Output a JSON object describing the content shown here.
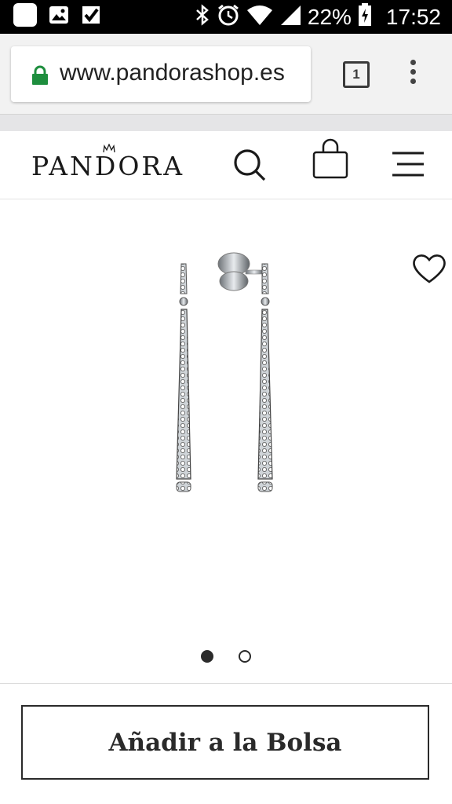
{
  "status_bar": {
    "battery": "22%",
    "time": "17:52"
  },
  "browser": {
    "url": "www.pandorashop.es",
    "tab_count": "1"
  },
  "site": {
    "logo_text": "PANDORA"
  },
  "product": {
    "image_count": 2,
    "active_image": 1
  },
  "actions": {
    "add_to_bag_label": "Añadir a la Bolsa"
  },
  "colors": {
    "lock": "#1e8e3e",
    "text": "#2a2a2a"
  }
}
